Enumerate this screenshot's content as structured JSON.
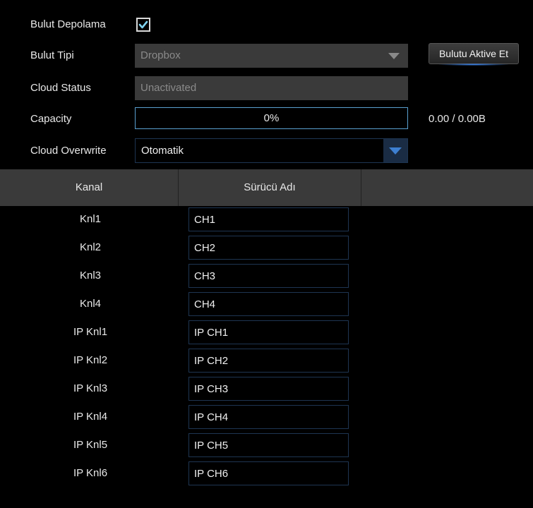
{
  "settings": {
    "cloud_storage_label": "Bulut Depolama",
    "cloud_storage_checked": true,
    "cloud_type_label": "Bulut Tipi",
    "cloud_type_value": "Dropbox",
    "activate_button": "Bulutu Aktive Et",
    "cloud_status_label": "Cloud Status",
    "cloud_status_value": "Unactivated",
    "capacity_label": "Capacity",
    "capacity_percent_text": "0%",
    "capacity_fraction": 0.0,
    "capacity_text": "0.00 / 0.00B",
    "overwrite_label": "Cloud Overwrite",
    "overwrite_value": "Otomatik"
  },
  "table": {
    "headers": [
      "Kanal",
      "Sürücü Adı",
      ""
    ],
    "rows": [
      {
        "channel": "Knl1",
        "name": "CH1"
      },
      {
        "channel": "Knl2",
        "name": "CH2"
      },
      {
        "channel": "Knl3",
        "name": "CH3"
      },
      {
        "channel": "Knl4",
        "name": "CH4"
      },
      {
        "channel": "IP Knl1",
        "name": "IP CH1"
      },
      {
        "channel": "IP Knl2",
        "name": "IP CH2"
      },
      {
        "channel": "IP Knl3",
        "name": "IP CH3"
      },
      {
        "channel": "IP Knl4",
        "name": "IP CH4"
      },
      {
        "channel": "IP Knl5",
        "name": "IP CH5"
      },
      {
        "channel": "IP Knl6",
        "name": "IP CH6"
      }
    ]
  },
  "colors": {
    "accent": "#3d7fd0",
    "check": "#7fd3f0",
    "field_gray": "#3a3a3a",
    "header_gray": "#3a3a3a"
  },
  "icons": {
    "checkbox": "check-icon",
    "dropdown": "triangle-down-icon"
  }
}
